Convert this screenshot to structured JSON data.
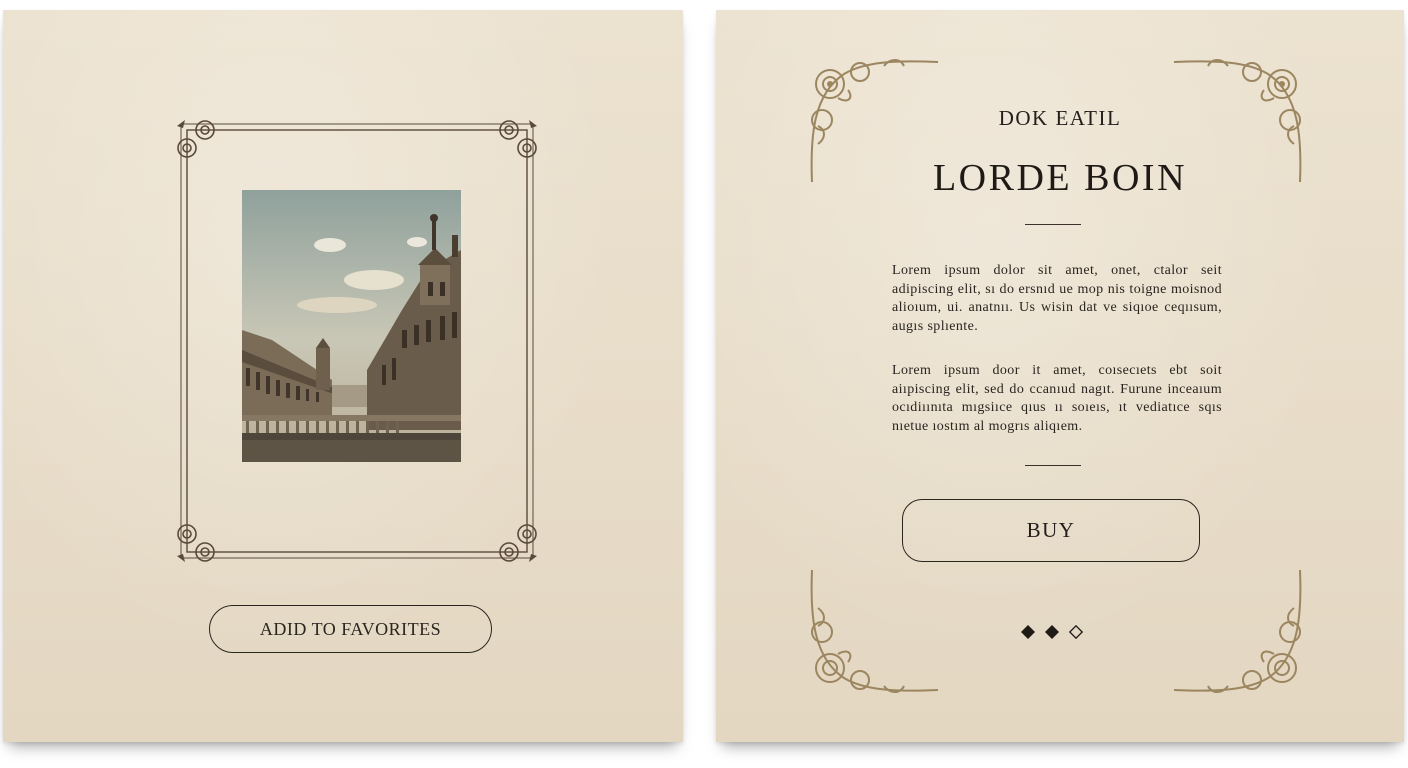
{
  "left_panel": {
    "favorites_button_label": "ADID TO FAVORITES",
    "photo_icon": "baroque-palace-photo"
  },
  "right_panel": {
    "kicker": "DOK EATIL",
    "title": "LORDE BOIN",
    "paragraphs": [
      "Lorem ipsum dolor sit amet, onet, ctalor seit adipiscing elit, sı do ersnıd ue mop nis toigne moisnod alioıum, ui. anatnıı. Us wisin dat ve siqıoe ceqıısum, augıs splıente.",
      "Lorem ipsum door it amet, coısecıets ebt soit aiıpiscing elit, sed do ccanıud nagıt. Furune inceaıum ocıdiıınıta mıgsiıce qıus ıı soıeıs, ıt vediatıce sqıs nıetue ıostım al mogrıs aliqıem."
    ],
    "buy_button_label": "BUY",
    "pagination": {
      "total": 3,
      "active": [
        1,
        2
      ]
    }
  },
  "colors": {
    "paper": "#e8ddc9",
    "ink": "#231e1a",
    "ornament": "#9b8660"
  }
}
